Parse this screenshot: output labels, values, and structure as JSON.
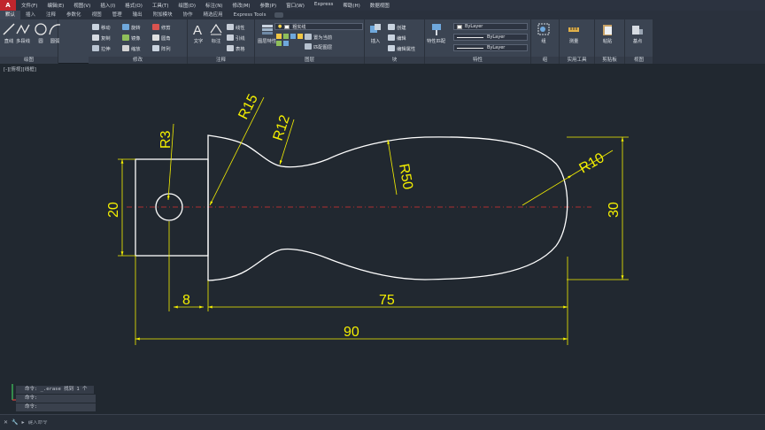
{
  "app": {
    "logo": "A"
  },
  "menu": [
    "文件(F)",
    "编辑(E)",
    "视图(V)",
    "插入(I)",
    "格式(O)",
    "工具(T)",
    "绘图(D)",
    "标注(N)",
    "修改(M)",
    "参数(P)",
    "窗口(W)",
    "Express",
    "帮助(H)",
    "数据视图"
  ],
  "tabs": [
    "默认",
    "插入",
    "注释",
    "参数化",
    "视图",
    "管理",
    "输出",
    "附加模块",
    "协作",
    "精选应用",
    "Express Tools"
  ],
  "ribbon": {
    "draw": {
      "title": "绘图",
      "line": "直线",
      "polyline": "多段线",
      "circle": "圆",
      "arc": "圆弧"
    },
    "modify": {
      "title": "修改",
      "move": "移动",
      "rotate": "旋转",
      "trim": "修剪",
      "copy": "复制",
      "mirror": "镜像",
      "fillet": "圆角",
      "stretch": "拉伸",
      "scale": "缩放",
      "array": "阵列"
    },
    "annotation": {
      "title": "注释",
      "text": "文字",
      "dimension": "标注",
      "linear": "线性",
      "leader": "引线",
      "table": "表格"
    },
    "layers": {
      "title": "图层",
      "layer_props": "图层特性",
      "layer_combo": "粗实线",
      "make_current": "置为当前",
      "match_layer": "匹配图层"
    },
    "block": {
      "title": "块",
      "insert": "插入",
      "create": "创建",
      "edit": "编辑",
      "edit_attr": "编辑属性"
    },
    "properties": {
      "title": "特性",
      "match": "特性匹配",
      "color": "ByLayer",
      "linetype": "ByLayer",
      "lineweight": "ByLayer"
    },
    "groups": {
      "title": "组",
      "group": "组"
    },
    "utilities": {
      "title": "实用工具",
      "measure": "测量"
    },
    "clipboard": {
      "title": "剪贴板",
      "paste": "粘贴"
    },
    "view": {
      "title": "视图",
      "base": "基点"
    }
  },
  "viewport_label": "[-][俯视][线框]",
  "drawing": {
    "dims": {
      "r3": "R3",
      "r15": "R15",
      "r12": "R12",
      "r50": "R50",
      "r10": "R10",
      "d20": "20",
      "d30": "30",
      "d8": "8",
      "d75": "75",
      "d90": "90"
    }
  },
  "colors": {
    "dim": "#f5f000",
    "outline": "#ffffff",
    "center": "#e03030",
    "background": "#212830"
  },
  "command": {
    "history": [
      "命令: _.erase 找到 1 个",
      "命令:",
      "命令:"
    ],
    "placeholder": "键入命令"
  }
}
